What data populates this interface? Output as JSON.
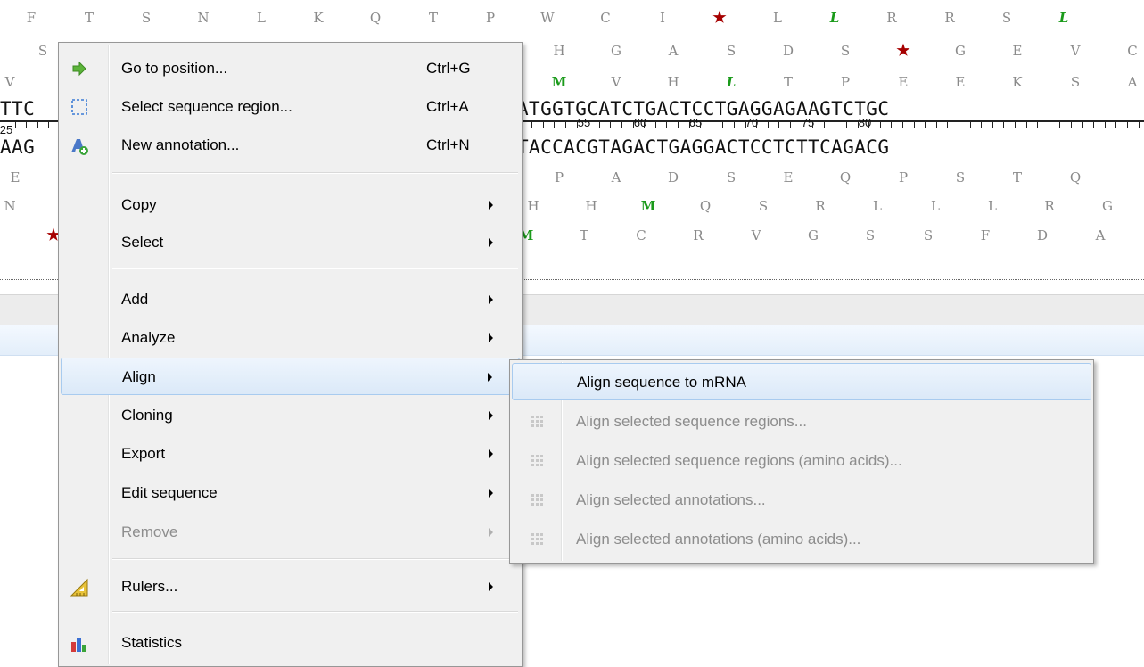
{
  "sequence_view": {
    "frame1": [
      {
        "t": "F",
        "k": ""
      },
      {
        "t": "T",
        "k": ""
      },
      {
        "t": "S",
        "k": ""
      },
      {
        "t": "N",
        "k": ""
      },
      {
        "t": "L",
        "k": ""
      },
      {
        "t": "K",
        "k": ""
      },
      {
        "t": "Q",
        "k": ""
      },
      {
        "t": "T",
        "k": ""
      },
      {
        "t": "P",
        "k": ""
      },
      {
        "t": "W",
        "k": ""
      },
      {
        "t": "C",
        "k": ""
      },
      {
        "t": "I",
        "k": ""
      },
      {
        "t": "★",
        "k": "stop"
      },
      {
        "t": "L",
        "k": ""
      },
      {
        "t": "L",
        "k": "leu"
      },
      {
        "t": "R",
        "k": ""
      },
      {
        "t": "R",
        "k": ""
      },
      {
        "t": "S",
        "k": ""
      },
      {
        "t": "L",
        "k": "leu"
      }
    ],
    "frame2": [
      {
        "t": "S",
        "k": ""
      },
      {
        "t": "H",
        "k": ""
      },
      {
        "t": "G",
        "k": ""
      },
      {
        "t": "A",
        "k": ""
      },
      {
        "t": "S",
        "k": ""
      },
      {
        "t": "D",
        "k": ""
      },
      {
        "t": "S",
        "k": ""
      },
      {
        "t": "★",
        "k": "stop"
      },
      {
        "t": "G",
        "k": ""
      },
      {
        "t": "E",
        "k": ""
      },
      {
        "t": "V",
        "k": ""
      },
      {
        "t": "C",
        "k": ""
      }
    ],
    "frame3": [
      {
        "t": "V",
        "k": ""
      },
      {
        "t": "M",
        "k": "met"
      },
      {
        "t": "V",
        "k": ""
      },
      {
        "t": "H",
        "k": ""
      },
      {
        "t": "L",
        "k": "leu"
      },
      {
        "t": "T",
        "k": ""
      },
      {
        "t": "P",
        "k": ""
      },
      {
        "t": "E",
        "k": ""
      },
      {
        "t": "E",
        "k": ""
      },
      {
        "t": "K",
        "k": ""
      },
      {
        "t": "S",
        "k": ""
      },
      {
        "t": "A",
        "k": ""
      }
    ],
    "forward_left": "TTC",
    "forward_right": "ATGGTGCATCTGACTCCTGAGGAGAAGTCTGC",
    "reverse_left": "AAG",
    "reverse_right": "TACCACGTAGACTGAGGACTCCTCTTCAGACG",
    "ruler_left": "25",
    "ruler_numbers": [
      "55",
      "60",
      "65",
      "70",
      "75",
      "80"
    ],
    "frame4": [
      {
        "t": "E",
        "k": ""
      },
      {
        "t": "P",
        "k": ""
      },
      {
        "t": "A",
        "k": ""
      },
      {
        "t": "D",
        "k": ""
      },
      {
        "t": "S",
        "k": ""
      },
      {
        "t": "E",
        "k": ""
      },
      {
        "t": "Q",
        "k": ""
      },
      {
        "t": "P",
        "k": ""
      },
      {
        "t": "S",
        "k": ""
      },
      {
        "t": "T",
        "k": ""
      },
      {
        "t": "Q",
        "k": ""
      }
    ],
    "frame5": [
      {
        "t": "N",
        "k": ""
      },
      {
        "t": "H",
        "k": ""
      },
      {
        "t": "H",
        "k": ""
      },
      {
        "t": "M",
        "k": "met"
      },
      {
        "t": "Q",
        "k": ""
      },
      {
        "t": "S",
        "k": ""
      },
      {
        "t": "R",
        "k": ""
      },
      {
        "t": "L",
        "k": ""
      },
      {
        "t": "L",
        "k": ""
      },
      {
        "t": "L",
        "k": ""
      },
      {
        "t": "R",
        "k": ""
      },
      {
        "t": "G",
        "k": ""
      }
    ],
    "frame6": [
      {
        "t": "★",
        "k": "stop"
      },
      {
        "t": "M",
        "k": "met"
      },
      {
        "t": "T",
        "k": ""
      },
      {
        "t": "C",
        "k": ""
      },
      {
        "t": "R",
        "k": ""
      },
      {
        "t": "V",
        "k": ""
      },
      {
        "t": "G",
        "k": ""
      },
      {
        "t": "S",
        "k": ""
      },
      {
        "t": "S",
        "k": ""
      },
      {
        "t": "F",
        "k": ""
      },
      {
        "t": "D",
        "k": ""
      },
      {
        "t": "A",
        "k": ""
      }
    ]
  },
  "context_menu": {
    "items": [
      {
        "label": "Go to position...",
        "shortcut": "Ctrl+G",
        "icon": "green-arrow-icon"
      },
      {
        "label": "Select sequence region...",
        "shortcut": "Ctrl+A",
        "icon": "selection-box-icon"
      },
      {
        "label": "New annotation...",
        "shortcut": "Ctrl+N",
        "icon": "new-annotation-icon"
      },
      {
        "label": "Copy"
      },
      {
        "label": "Select"
      },
      {
        "label": "Add"
      },
      {
        "label": "Analyze"
      },
      {
        "label": "Align"
      },
      {
        "label": "Cloning"
      },
      {
        "label": "Export"
      },
      {
        "label": "Edit sequence"
      },
      {
        "label": "Remove",
        "disabled": true
      },
      {
        "label": "Rulers...",
        "icon": "ruler-icon"
      },
      {
        "label": "Statistics",
        "icon": "bar-chart-icon"
      }
    ]
  },
  "align_submenu": {
    "items": [
      {
        "label": "Align sequence to mRNA"
      },
      {
        "label": "Align selected sequence regions...",
        "disabled": true
      },
      {
        "label": "Align selected sequence regions (amino acids)...",
        "disabled": true
      },
      {
        "label": "Align selected annotations...",
        "disabled": true
      },
      {
        "label": "Align selected annotations (amino acids)...",
        "disabled": true
      }
    ]
  },
  "colors": {
    "amino_acid": "#8a8a8a",
    "methionine": "#1a9a1a",
    "stop_codon": "#a60000",
    "menu_highlight_border": "#a8cbef",
    "menu_background": "#f0f0f0",
    "disabled_text": "#8d8d8d"
  }
}
